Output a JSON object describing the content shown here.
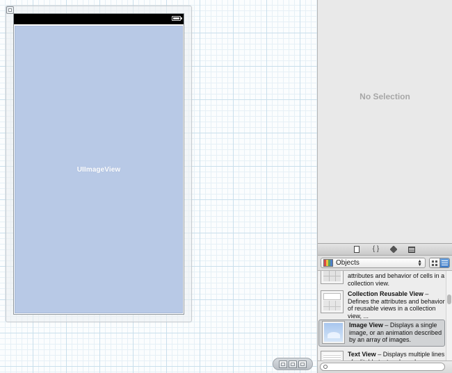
{
  "canvas": {
    "image_view_label": "UIImageView"
  },
  "inspector": {
    "no_selection": "No Selection"
  },
  "library": {
    "tabs": [
      "file-template-icon",
      "code-snippet-icon",
      "object-cube-icon",
      "media-icon"
    ],
    "filter": {
      "selected": "Objects"
    },
    "items": [
      {
        "title": "",
        "description": "attributes and behavior of cells in a collection view."
      },
      {
        "title": "Collection Reusable View",
        "description": " – Defines the attributes and behavior of reusable views in a collection view, ..."
      },
      {
        "title": "Image View",
        "description": " – Displays a single image, or an animation described by an array of images."
      },
      {
        "title": "Text View",
        "description": " – Displays multiple lines of editable text and sends an action"
      }
    ],
    "search": {
      "placeholder": ""
    }
  },
  "colors": {
    "image_view_bg": "#b8c9e6",
    "selection_bg": "#d1d3d5",
    "panel_bg": "#e9e9e9"
  }
}
